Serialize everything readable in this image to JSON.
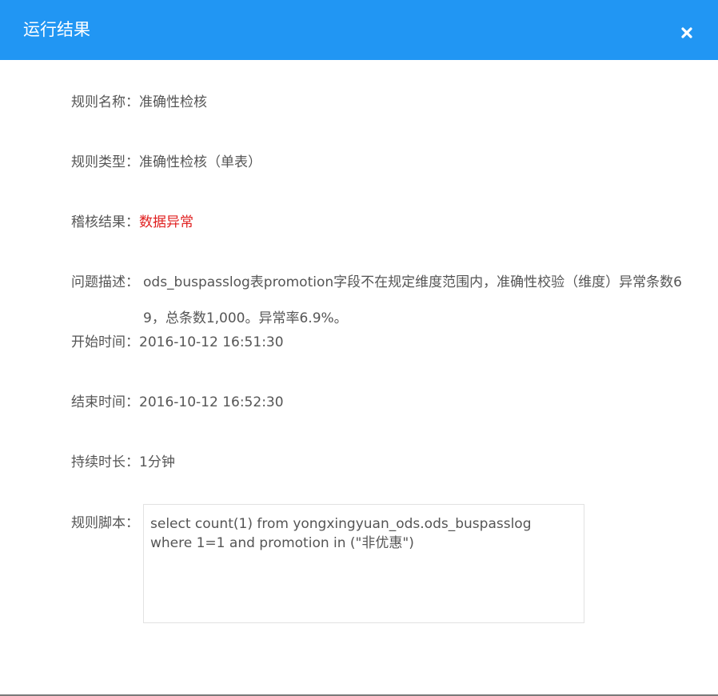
{
  "dialog": {
    "title": "运行结果",
    "close_icon": "close-icon"
  },
  "fields": {
    "rule_name": {
      "label": "规则名称：",
      "value": "准确性检核"
    },
    "rule_type": {
      "label": "规则类型：",
      "value": "准确性检核（单表）"
    },
    "check_result": {
      "label": "稽核结果：",
      "value": "数据异常",
      "value_color": "#e02020"
    },
    "description": {
      "label": "问题描述：",
      "value": "ods_buspasslog表promotion字段不在规定维度范围内，准确性校验（维度）异常条数69，总条数1,000。异常率6.9%。"
    },
    "start_time": {
      "label": "开始时间：",
      "value": "2016-10-12 16:51:30"
    },
    "end_time": {
      "label": "结束时间：",
      "value": "2016-10-12 16:52:30"
    },
    "duration": {
      "label": "持续时长：",
      "value": "1分钟"
    },
    "script": {
      "label": "规则脚本：",
      "value": "select count(1) from yongxingyuan_ods.ods_buspasslog\nwhere 1=1 and promotion in (\"非优惠\")"
    }
  },
  "colors": {
    "header_bg": "#2196f3",
    "text": "#555555",
    "error": "#e02020"
  }
}
